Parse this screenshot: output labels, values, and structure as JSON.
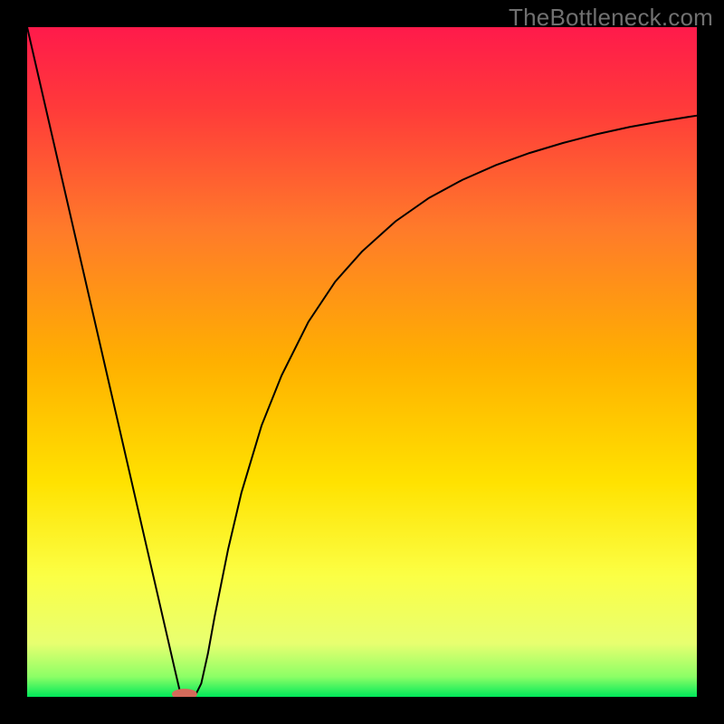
{
  "watermark": "TheBottleneck.com",
  "chart_data": {
    "type": "line",
    "title": "",
    "xlabel": "",
    "ylabel": "",
    "xlim": [
      0,
      100
    ],
    "ylim": [
      0,
      100
    ],
    "grid": false,
    "legend": false,
    "background_gradient": {
      "stops": [
        {
          "offset": 0.0,
          "color": "#ff1a4b"
        },
        {
          "offset": 0.12,
          "color": "#ff3a3a"
        },
        {
          "offset": 0.3,
          "color": "#ff7a2a"
        },
        {
          "offset": 0.5,
          "color": "#ffb000"
        },
        {
          "offset": 0.68,
          "color": "#ffe200"
        },
        {
          "offset": 0.82,
          "color": "#fbff45"
        },
        {
          "offset": 0.92,
          "color": "#e8ff70"
        },
        {
          "offset": 0.97,
          "color": "#8cff66"
        },
        {
          "offset": 1.0,
          "color": "#00e85a"
        }
      ]
    },
    "series": [
      {
        "name": "bottleneck-curve",
        "color": "#000000",
        "stroke_width": 2,
        "x": [
          0,
          2,
          4,
          6,
          8,
          10,
          12,
          14,
          16,
          18,
          20,
          22,
          23,
          24,
          25,
          26,
          27,
          28,
          30,
          32,
          35,
          38,
          42,
          46,
          50,
          55,
          60,
          65,
          70,
          75,
          80,
          85,
          90,
          95,
          100
        ],
        "y": [
          100,
          91.3,
          82.6,
          73.9,
          65.2,
          56.5,
          47.8,
          39.1,
          30.4,
          21.7,
          13.0,
          4.3,
          0.0,
          0.0,
          0.0,
          2.0,
          6.5,
          12.0,
          22.0,
          30.5,
          40.5,
          48.0,
          56.0,
          62.0,
          66.5,
          71.0,
          74.5,
          77.2,
          79.4,
          81.2,
          82.7,
          84.0,
          85.1,
          86.0,
          86.8
        ]
      }
    ],
    "marker": {
      "x": 23.5,
      "y": 0.4,
      "color": "#d46a5a",
      "rx": 14,
      "ry": 6
    }
  }
}
